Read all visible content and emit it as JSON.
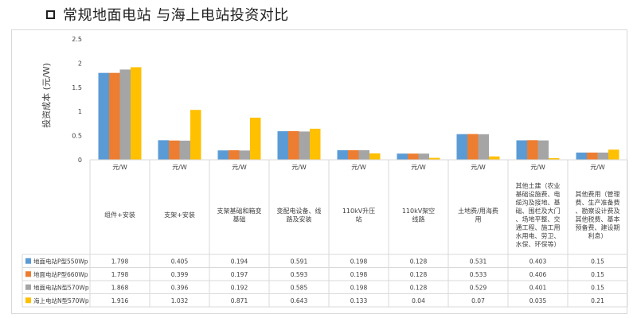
{
  "page": {
    "title": "常规地面电站 与海上电站投资对比"
  },
  "chart_data": {
    "type": "bar",
    "title": "",
    "xlabel": "",
    "ylabel": "投资成本 (元/W)",
    "ylim": [
      0,
      2.5
    ],
    "yticks": [
      "0",
      "0.5",
      "1",
      "1.5",
      "2",
      "2.5"
    ],
    "grid": false,
    "legend": "table-left",
    "unit_label": "元/W",
    "categories": [
      "组件+安装",
      "支架+安装",
      "支架基础和箱变基础",
      "变配电设备、线路及安装",
      "110kV升压站",
      "110kV架空线路",
      "土地费/用海费用",
      "其他土建（农业基础设施费、电缆沟及接地、基础、围栏及大门、场地平整、交通工程、施工用水用电、劳卫、水保、环保等）",
      "其他费用（管理费、生产准备费、勘察设计费及其他税费、基本预备费、建设期利息）"
    ],
    "series": [
      {
        "name": "地面电站P型550Wp",
        "color": "#5b9bd5",
        "values": [
          1.798,
          0.405,
          0.194,
          0.591,
          0.198,
          0.128,
          0.531,
          0.403,
          0.15
        ],
        "labels": [
          "1.798",
          "0.405",
          "0.194",
          "0.591",
          "0.198",
          "0.128",
          "0.531",
          "0.403",
          "0.15"
        ]
      },
      {
        "name": "地面电站P型660Wp",
        "color": "#ed7d31",
        "values": [
          1.798,
          0.399,
          0.197,
          0.593,
          0.198,
          0.128,
          0.533,
          0.406,
          0.15
        ],
        "labels": [
          "1.798",
          "0.399",
          "0.197",
          "0.593",
          "0.198",
          "0.128",
          "0.533",
          "0.406",
          "0.15"
        ]
      },
      {
        "name": "地面电站N型570Wp",
        "color": "#a5a5a5",
        "values": [
          1.868,
          0.396,
          0.192,
          0.585,
          0.198,
          0.128,
          0.529,
          0.401,
          0.15
        ],
        "labels": [
          "1.868",
          "0.396",
          "0.192",
          "0.585",
          "0.198",
          "0.128",
          "0.529",
          "0.401",
          "0.15"
        ]
      },
      {
        "name": "海上电站N型570Wp",
        "color": "#ffc000",
        "values": [
          1.916,
          1.032,
          0.871,
          0.643,
          0.133,
          0.04,
          0.07,
          0.035,
          0.21
        ],
        "labels": [
          "1.916",
          "1.032",
          "0.871",
          "0.643",
          "0.133",
          "0.04",
          "0.07",
          "0.035",
          "0.21"
        ]
      }
    ]
  }
}
